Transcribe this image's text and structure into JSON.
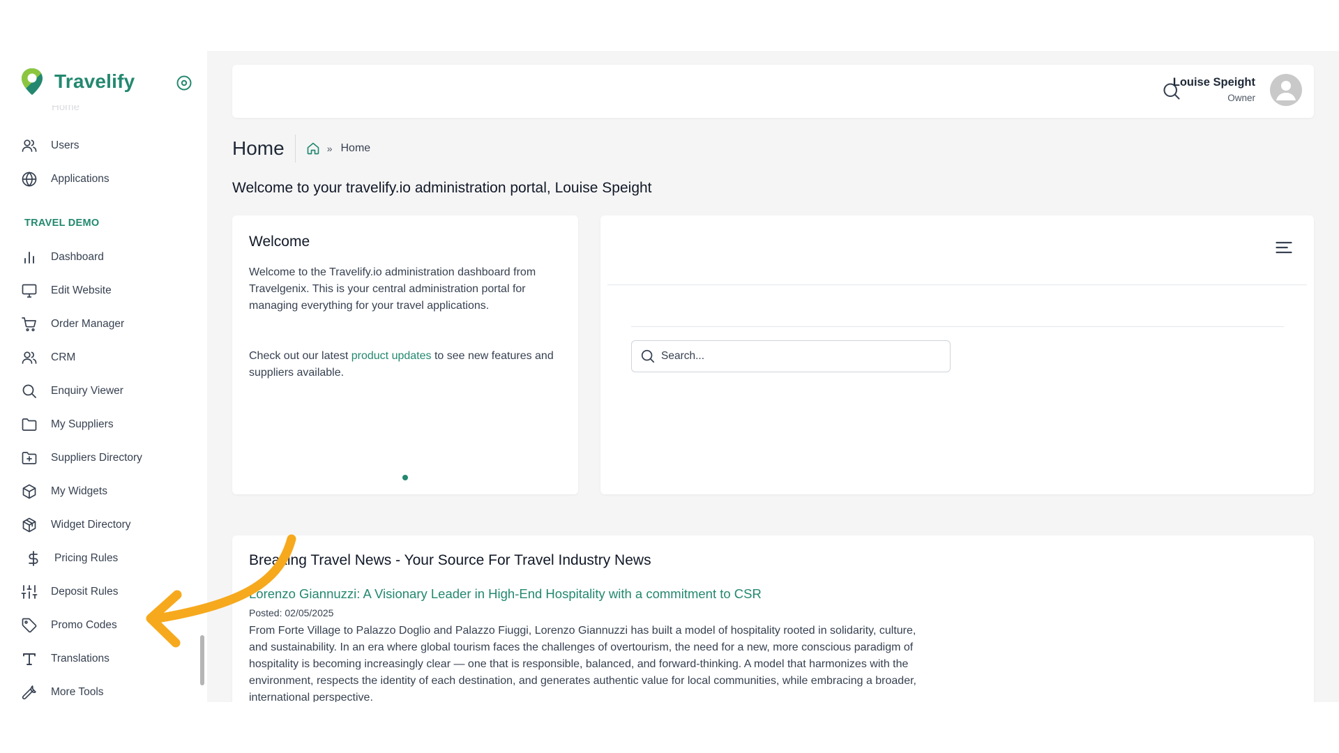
{
  "brand": {
    "name": "Travelify",
    "accent": "#23886f"
  },
  "sidebar": {
    "ghost_item": "Home",
    "top_items": [
      {
        "label": "Users",
        "icon": "users-icon"
      },
      {
        "label": "Applications",
        "icon": "globe-icon"
      }
    ],
    "section_title": "TRAVEL DEMO",
    "items": [
      {
        "label": "Dashboard",
        "icon": "bar-chart-icon"
      },
      {
        "label": "Edit Website",
        "icon": "monitor-icon"
      },
      {
        "label": "Order Manager",
        "icon": "cart-icon"
      },
      {
        "label": "CRM",
        "icon": "users-icon"
      },
      {
        "label": "Enquiry Viewer",
        "icon": "search-icon"
      },
      {
        "label": "My Suppliers",
        "icon": "folder-icon"
      },
      {
        "label": "Suppliers Directory",
        "icon": "folder-plus-icon"
      },
      {
        "label": "My Widgets",
        "icon": "cube-icon"
      },
      {
        "label": "Widget Directory",
        "icon": "cubes-icon"
      },
      {
        "label": "Pricing Rules",
        "icon": "dollar-icon"
      },
      {
        "label": "Deposit Rules",
        "icon": "sliders-icon"
      },
      {
        "label": "Promo Codes",
        "icon": "tag-icon"
      },
      {
        "label": "Translations",
        "icon": "type-icon"
      },
      {
        "label": "More Tools",
        "icon": "wrench-icon"
      }
    ]
  },
  "header": {
    "user_name": "Louise Speight",
    "user_role": "Owner"
  },
  "page": {
    "title": "Home",
    "breadcrumb_sep": "»",
    "breadcrumb_current": "Home",
    "welcome_message": "Welcome to your travelify.io administration portal, Louise Speight"
  },
  "welcome_card": {
    "title": "Welcome",
    "para1": "Welcome to the Travelify.io administration dashboard from Travelgenix. This is your central administration portal for managing everything for your travel applications.",
    "para2_before": "Check out our latest ",
    "para2_link": "product updates",
    "para2_after": " to see new features and suppliers available."
  },
  "feed_card": {
    "search_placeholder": "Search..."
  },
  "news": {
    "heading": "Breaking Travel News - Your Source For Travel Industry News",
    "article_title": "Lorenzo Giannuzzi: A Visionary Leader in High-End Hospitality with a commitment to CSR",
    "posted": "Posted: 02/05/2025",
    "excerpt": "From Forte Village to Palazzo Doglio and Palazzo Fiuggi, Lorenzo Giannuzzi has built a model of hospitality rooted in solidarity, culture, and sustainability. In an era where global tourism faces the challenges of overtourism, the need for a new, more conscious paradigm of hospitality is becoming increasingly clear — one that is responsible, balanced, and forward-thinking. A model that harmonizes with the environment, respects the identity of each destination, and generates authentic value for local communities, while embracing a broader, international perspective."
  },
  "callout": {
    "color": "#f6a91d",
    "points_to": "Pricing Rules"
  }
}
